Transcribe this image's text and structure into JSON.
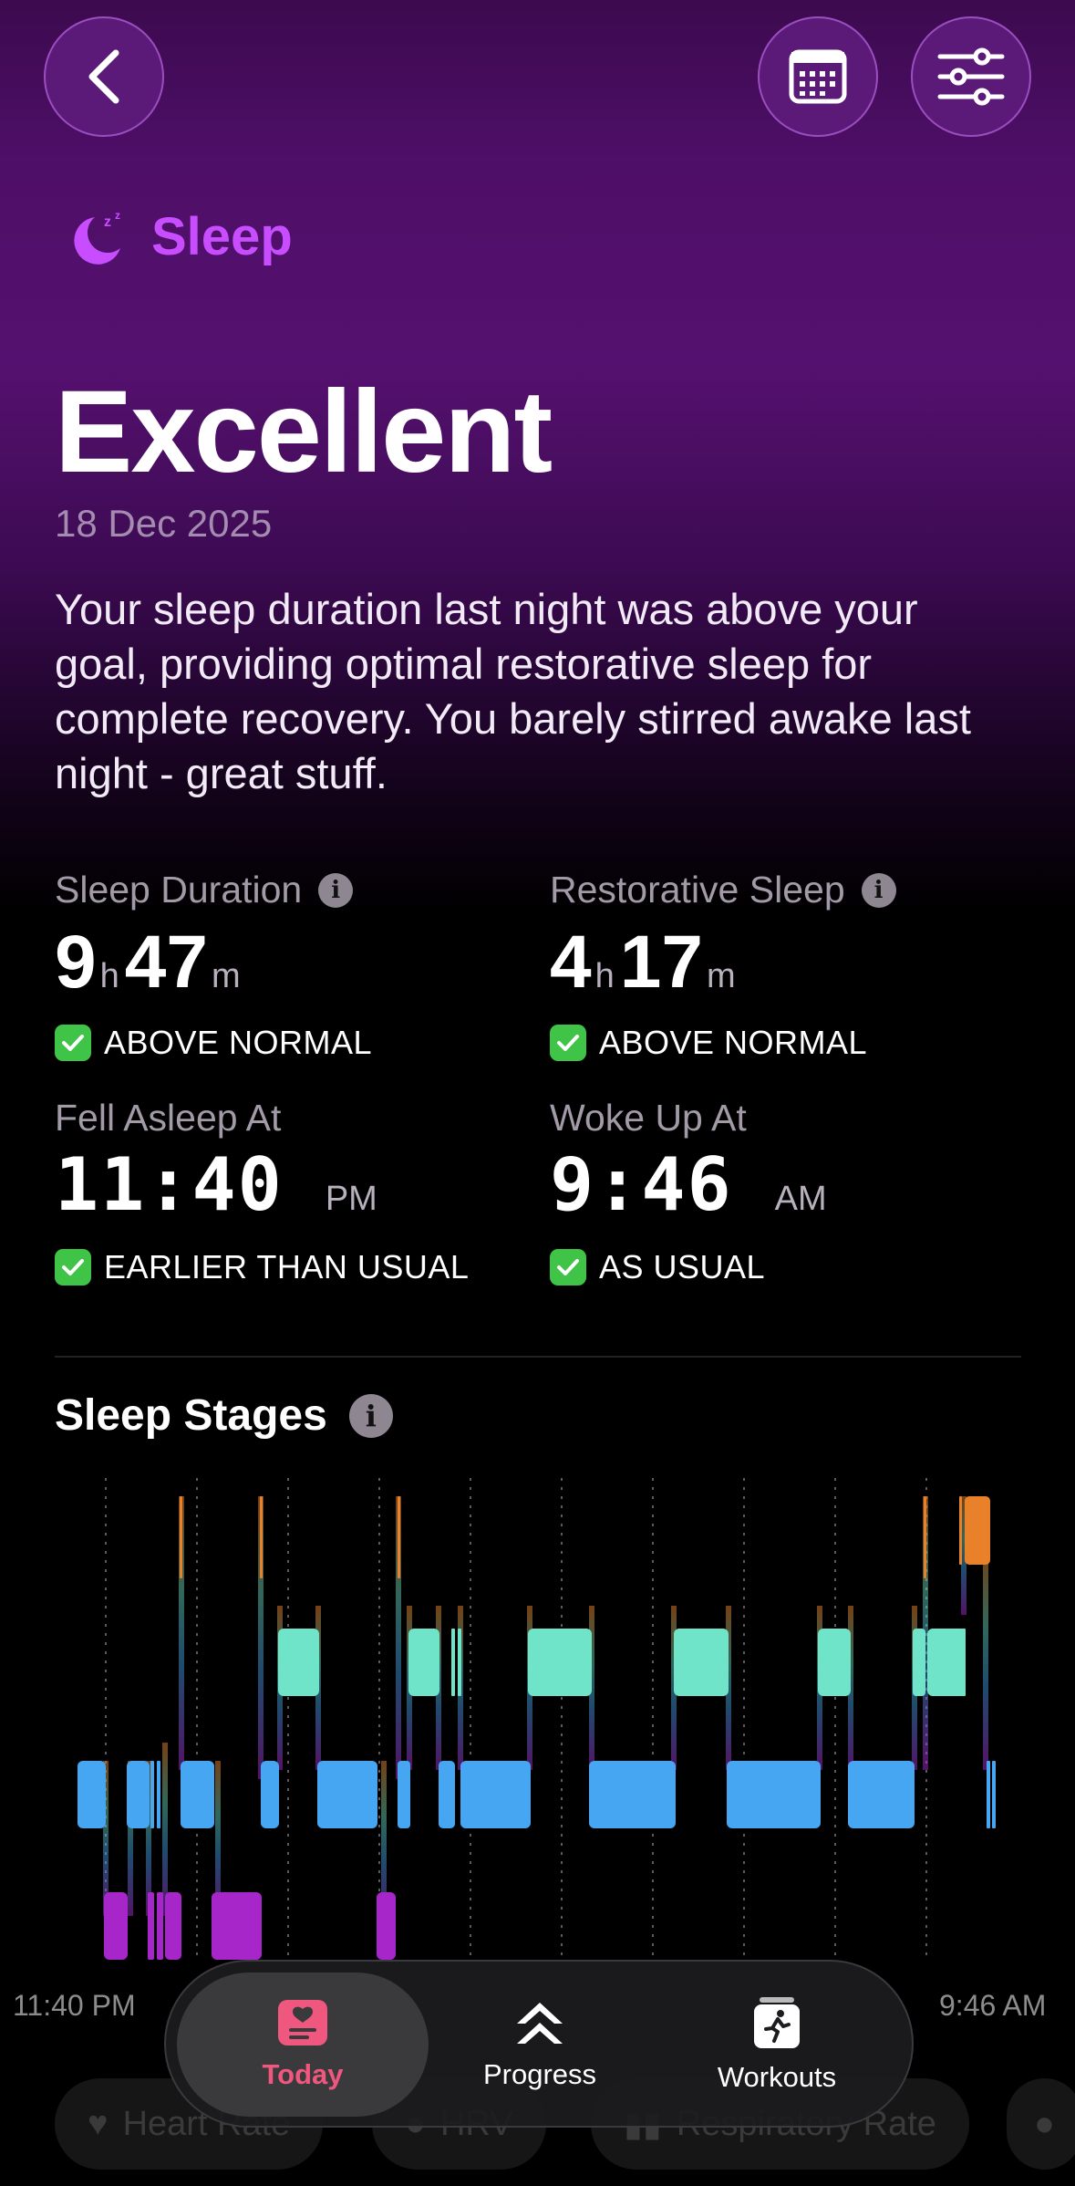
{
  "header": {
    "section_label": "Sleep"
  },
  "summary": {
    "title": "Excellent",
    "date": "18 Dec 2025",
    "description": "Your sleep duration last night was above your goal, providing optimal restorative sleep for complete recovery. You barely stirred awake last night - great stuff."
  },
  "metrics": {
    "sleep_duration": {
      "label": "Sleep Duration",
      "hours": "9",
      "h_unit": "h",
      "minutes": "47",
      "m_unit": "m",
      "status": "ABOVE NORMAL"
    },
    "restorative_sleep": {
      "label": "Restorative Sleep",
      "hours": "4",
      "h_unit": "h",
      "minutes": "17",
      "m_unit": "m",
      "status": "ABOVE NORMAL"
    },
    "fell_asleep": {
      "label": "Fell Asleep At",
      "time": "11:40",
      "ampm": "PM",
      "status": "EARLIER THAN USUAL"
    },
    "woke_up": {
      "label": "Woke Up At",
      "time": "9:46",
      "ampm": "AM",
      "status": "AS USUAL"
    }
  },
  "sleep_stages": {
    "title": "Sleep Stages",
    "start_label": "11:40 PM",
    "end_label": "9:46 AM",
    "colors": {
      "awake": "#e9812a",
      "rem": "#6fe4c9",
      "light": "#47a6f2",
      "deep": "#a726c9"
    }
  },
  "chips": [
    "Heart Rate",
    "HRV",
    "Respiratory Rate"
  ],
  "tabs": [
    {
      "label": "Today",
      "icon": "today-icon",
      "active": true
    },
    {
      "label": "Progress",
      "icon": "progress-icon",
      "active": false
    },
    {
      "label": "Workouts",
      "icon": "workouts-icon",
      "active": false
    }
  ],
  "icons": [
    "back-chevron-icon",
    "calendar-icon",
    "sliders-icon",
    "sleep-moon-icon",
    "info-icon",
    "check-icon"
  ],
  "accent_color": "#c84dff"
}
